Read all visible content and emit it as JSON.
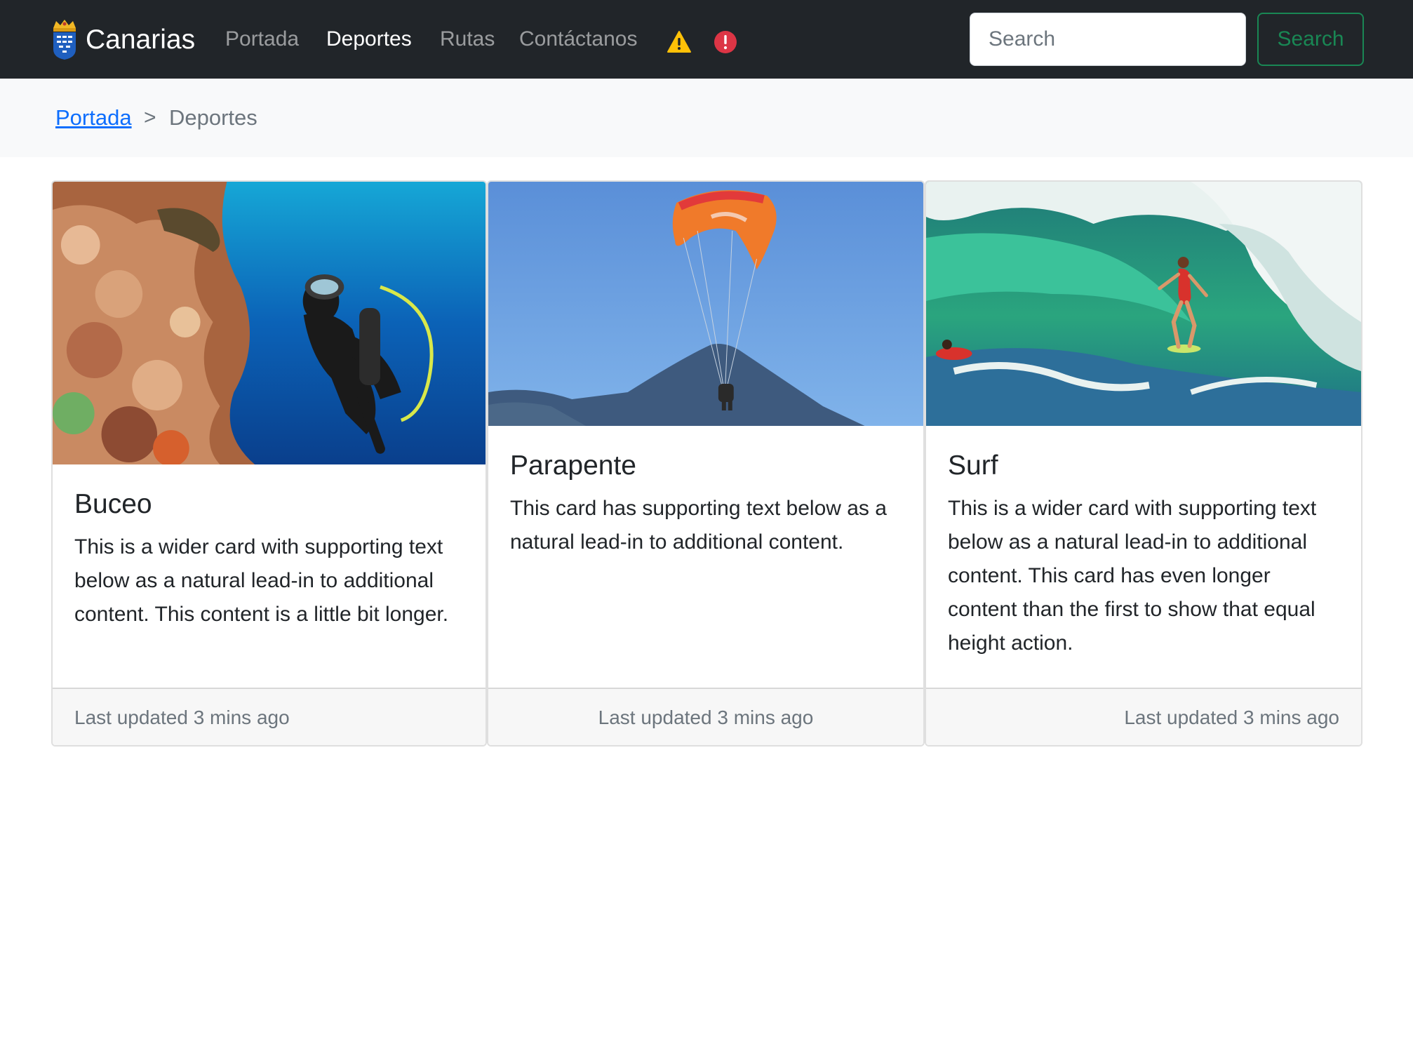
{
  "navbar": {
    "brand": "Canarias",
    "links": [
      {
        "label": "Portada",
        "active": false
      },
      {
        "label": "Deportes",
        "active": true
      },
      {
        "label": "Rutas",
        "active": false
      },
      {
        "label": "Contáctanos",
        "active": false
      }
    ],
    "icons": [
      "warning-icon",
      "error-icon"
    ],
    "search": {
      "placeholder": "Search",
      "value": "",
      "button_label": "Search"
    }
  },
  "breadcrumb": {
    "home": "Portada",
    "separator": ">",
    "current": "Deportes"
  },
  "cards": [
    {
      "title": "Buceo",
      "text": "This is a wider card with supporting text below as a natural lead-in to additional content. This content is a little bit longer.",
      "footer": "Last updated 3 mins ago",
      "footer_align": "left"
    },
    {
      "title": "Parapente",
      "text": "This card has supporting text below as a natural lead-in to additional content.",
      "footer": "Last updated 3 mins ago",
      "footer_align": "center"
    },
    {
      "title": "Surf",
      "text": "This is a wider card with supporting text below as a natural lead-in to additional content. This card has even longer content than the first to show that equal height action.",
      "footer": "Last updated 3 mins ago",
      "footer_align": "right"
    }
  ],
  "colors": {
    "navbar_bg": "#212529",
    "breadcrumb_bg": "#f8f9fa",
    "link": "#0d6efd",
    "success": "#198754",
    "warning": "#ffc107",
    "danger": "#dc3545"
  }
}
